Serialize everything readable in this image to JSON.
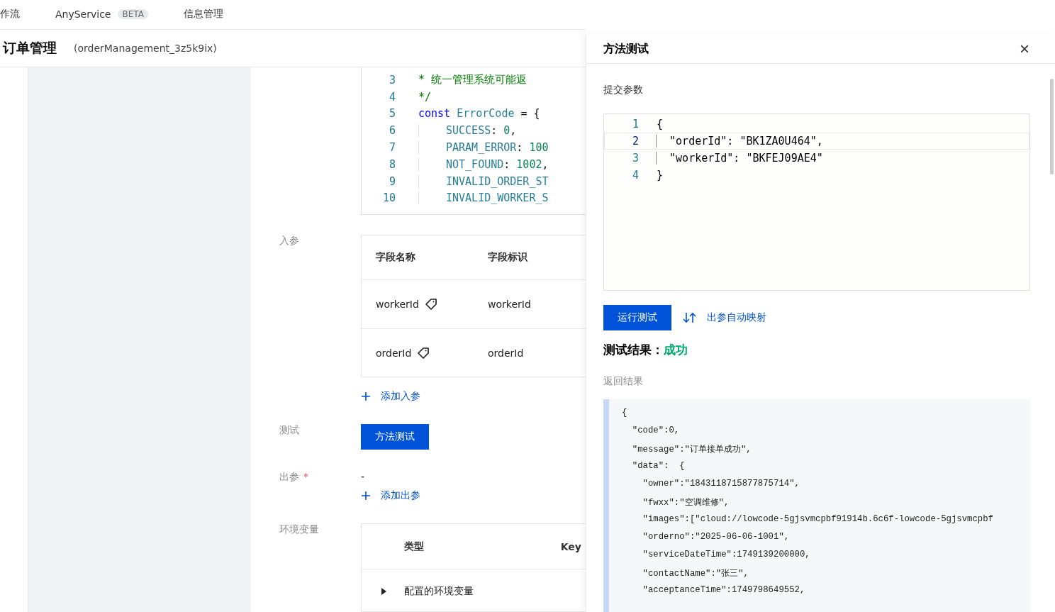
{
  "top_nav": {
    "items": [
      {
        "label": "作流",
        "selected": false
      },
      {
        "label": "AnyService",
        "badge": "BETA",
        "selected": false
      },
      {
        "label": "信息管理",
        "selected": false
      }
    ]
  },
  "header": {
    "title": "订单管理",
    "identifier": "(orderManagement_3z5k9ix)"
  },
  "code_editor": {
    "lines": [
      {
        "number": "3",
        "tokens": [
          {
            "kind": "comment",
            "text": "* 统一管理系统可能返"
          }
        ]
      },
      {
        "number": "4",
        "tokens": [
          {
            "kind": "comment",
            "text": "*/"
          }
        ]
      },
      {
        "number": "5",
        "tokens": [
          {
            "kind": "keyword",
            "text": "const "
          },
          {
            "kind": "name",
            "text": "ErrorCode"
          },
          {
            "kind": "plain",
            "text": " = {"
          }
        ]
      },
      {
        "number": "6",
        "indent": true,
        "tokens": [
          {
            "kind": "name",
            "text": "SUCCESS"
          },
          {
            "kind": "plain",
            "text": ": "
          },
          {
            "kind": "number",
            "text": "0"
          },
          {
            "kind": "plain",
            "text": ","
          }
        ]
      },
      {
        "number": "7",
        "indent": true,
        "tokens": [
          {
            "kind": "name",
            "text": "PARAM_ERROR"
          },
          {
            "kind": "plain",
            "text": ": "
          },
          {
            "kind": "number",
            "text": "100"
          }
        ]
      },
      {
        "number": "8",
        "indent": true,
        "tokens": [
          {
            "kind": "name",
            "text": "NOT_FOUND"
          },
          {
            "kind": "plain",
            "text": ": "
          },
          {
            "kind": "number",
            "text": "1002"
          },
          {
            "kind": "plain",
            "text": ","
          }
        ]
      },
      {
        "number": "9",
        "indent": true,
        "tokens": [
          {
            "kind": "name",
            "text": "INVALID_ORDER_ST"
          }
        ]
      },
      {
        "number": "10",
        "indent": true,
        "tokens": [
          {
            "kind": "name",
            "text": "INVALID_WORKER_S"
          }
        ]
      }
    ]
  },
  "input_params": {
    "label": "入参",
    "columns": [
      "字段名称",
      "字段标识"
    ],
    "rows": [
      {
        "name": "workerId",
        "identifier": "workerId"
      },
      {
        "name": "orderId",
        "identifier": "orderId"
      }
    ],
    "add_link": "添加入参"
  },
  "test": {
    "label": "测试",
    "button": "方法测试"
  },
  "output_params": {
    "label": "出参",
    "required_mark": "*",
    "value": "-",
    "add_link": "添加出参"
  },
  "env_vars": {
    "label": "环境变量",
    "columns": [
      "类型",
      "Key"
    ],
    "rows": [
      {
        "type": "配置的环境变量",
        "expanded": false
      }
    ]
  },
  "drawer": {
    "title": "方法测试",
    "close": "×",
    "submit_label": "提交参数",
    "json_editor": {
      "lines": [
        {
          "number": "1",
          "text": "{"
        },
        {
          "number": "2",
          "text": "  \"orderId\": \"BK1ZA0U464\",",
          "selected": true
        },
        {
          "number": "3",
          "text": "  \"workerId\": \"BKFEJ09AE4\"",
          "selected": false
        },
        {
          "number": "4",
          "text": "}"
        }
      ]
    },
    "run_button": "运行测试",
    "map_link": "出参自动映射",
    "result_label": "测试结果：",
    "result_value": "成功",
    "return_label": "返回结果",
    "return_lines": [
      "{",
      "  ″code″:0,",
      "  ″message″:″订单接单成功″,",
      "  ″data″:  {",
      "    ″owner″:″1843118715877875714″,",
      "    ″fwxx″:″空调维修″,",
      "    ″images″:[″cloud://lowcode-5gjsvmcpbf91914b.6c6f-lowcode-5gjsvmcpbf",
      "    ″orderno″:″2025-06-06-1001″,",
      "    ″serviceDateTime″:1749139200000,",
      "    ″contactName″:″张三″,",
      "    ″acceptanceTime″:1749798649552,"
    ]
  }
}
